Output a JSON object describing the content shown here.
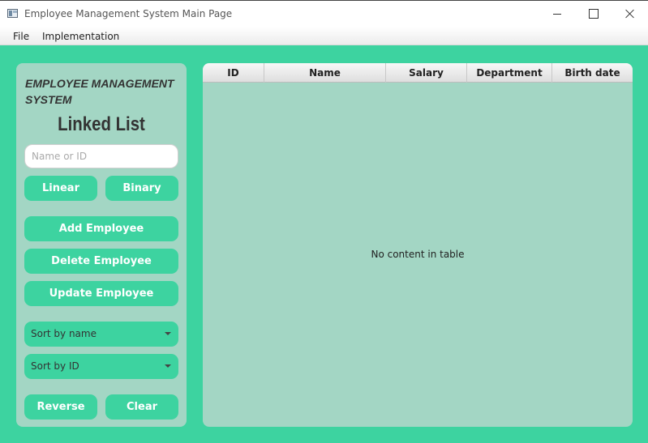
{
  "window": {
    "title": "Employee Management System Main Page"
  },
  "menubar": {
    "items": [
      "File",
      "Implementation"
    ]
  },
  "sidebar": {
    "header": "EMPLOYEE MANAGEMENT SYSTEM",
    "subtitle": "Linked List",
    "search": {
      "placeholder": "Name or ID",
      "value": ""
    },
    "search_buttons": [
      "Linear",
      "Binary"
    ],
    "actions": [
      "Add Employee",
      "Delete Employee",
      "Update Employee"
    ],
    "sort_name": "Sort by name",
    "sort_id": "Sort by ID",
    "bottom_buttons": [
      "Reverse",
      "Clear"
    ]
  },
  "table": {
    "columns": [
      "ID",
      "Name",
      "Salary",
      "Department",
      "Birth date"
    ],
    "rows": [],
    "placeholder": "No content in table"
  },
  "colors": {
    "background": "#3dd3a0",
    "panel": "#a3d6c4",
    "button": "#3dd3a0",
    "button_text": "#ffffff"
  }
}
